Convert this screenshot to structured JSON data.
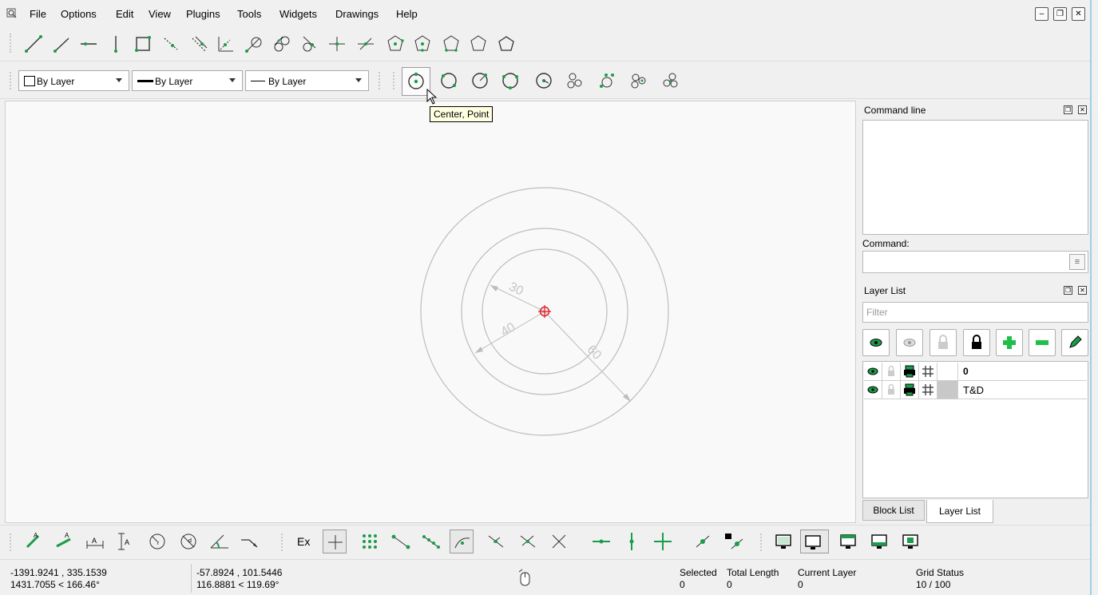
{
  "menu": {
    "file": "File",
    "options": "Options",
    "edit": "Edit",
    "view": "View",
    "plugins": "Plugins",
    "tools": "Tools",
    "widgets": "Widgets",
    "drawings": "Drawings",
    "help": "Help"
  },
  "pen": {
    "color": "By Layer",
    "width": "By Layer",
    "type": "By Layer"
  },
  "tooltip": "Center, Point",
  "dimensions": {
    "a": "30",
    "b": "40",
    "c": "60"
  },
  "command_panel": {
    "title": "Command line",
    "label": "Command:"
  },
  "layer_panel": {
    "title": "Layer List",
    "filter_placeholder": "Filter",
    "layers": [
      {
        "name": "0"
      },
      {
        "name": "T&D"
      }
    ]
  },
  "tabs": {
    "block_list": "Block List",
    "layer_list": "Layer List"
  },
  "bottom_toolbar": {
    "ex_label": "Ex"
  },
  "status": {
    "abs_coord": "-1391.9241 , 335.1539",
    "abs_polar": "1431.7055 < 166.46°",
    "rel_coord": "-57.8924 , 101.5446",
    "rel_polar": "116.8881 < 119.69°",
    "selected_label": "Selected",
    "selected_value": "0",
    "total_length_label": "Total Length",
    "total_length_value": "0",
    "current_layer_label": "Current Layer",
    "current_layer_value": "0",
    "grid_status_label": "Grid Status",
    "grid_status_value": "10 / 100"
  },
  "colors": {
    "accent_green": "#1a9d4a",
    "center_marker": "#e0202a",
    "drawing_gray": "#bdbdbd"
  }
}
